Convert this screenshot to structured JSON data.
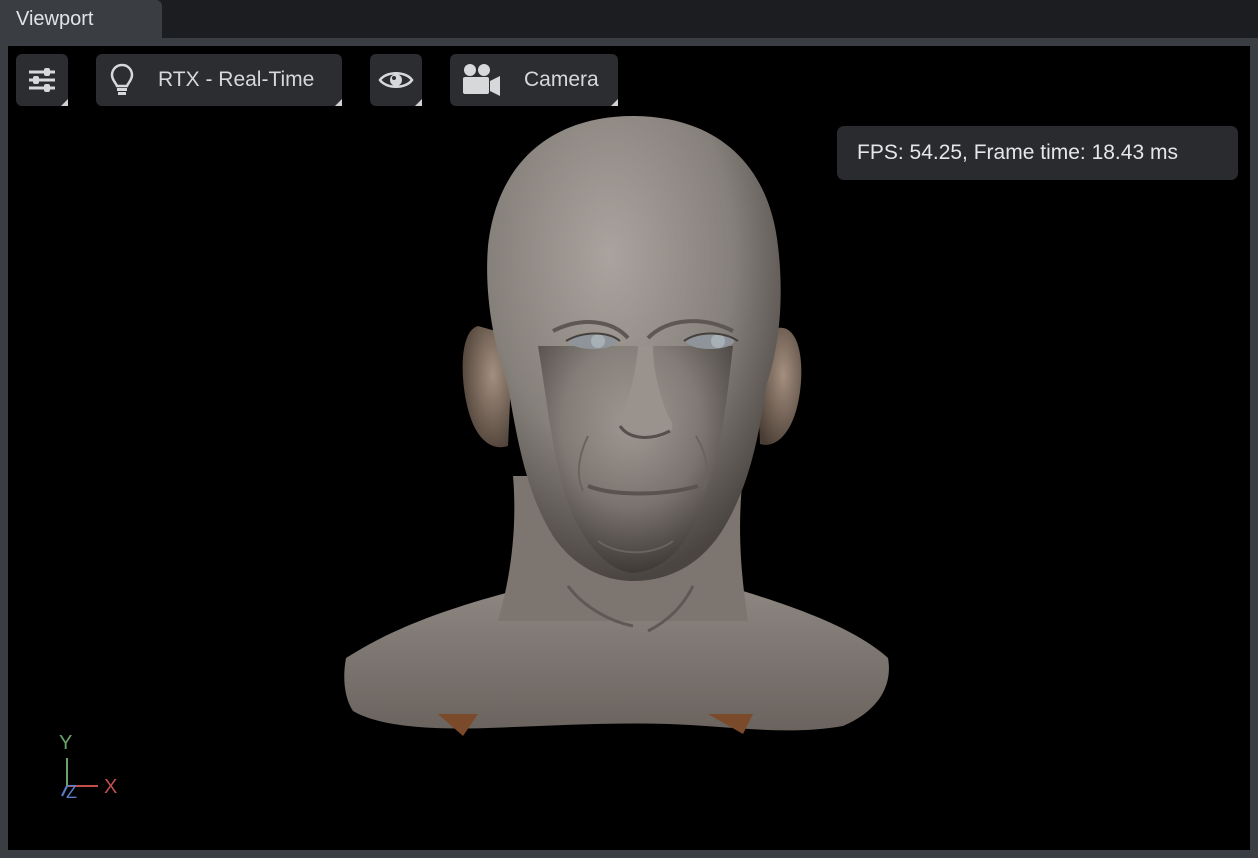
{
  "tab": {
    "title": "Viewport"
  },
  "toolbar": {
    "settings_icon": "sliders-icon",
    "renderer_icon": "lightbulb-icon",
    "renderer_label": "RTX - Real-Time",
    "visibility_icon": "eye-icon",
    "camera_icon": "movie-camera-icon",
    "camera_label": "Camera"
  },
  "stats": {
    "text": "FPS: 54.25, Frame time: 18.43 ms"
  },
  "gizmo": {
    "y": "Y",
    "x": "X",
    "z": "Z",
    "colors": {
      "x": "#c0504d",
      "y": "#6aa36a",
      "z": "#5b7fc7"
    }
  },
  "scene": {
    "model": "human-head-bust"
  }
}
